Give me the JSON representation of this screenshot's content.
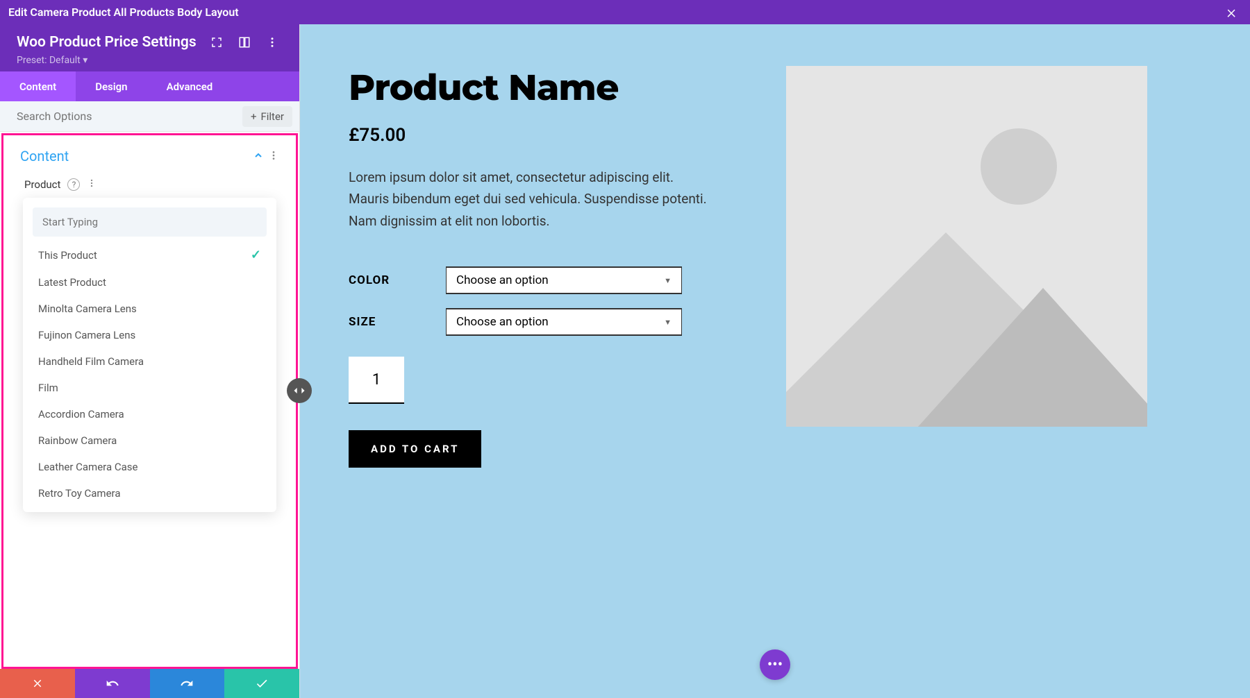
{
  "topBar": {
    "title": "Edit Camera Product All Products Body Layout"
  },
  "settingsHeader": {
    "title": "Woo Product Price Settings",
    "preset": "Preset: Default"
  },
  "tabs": {
    "content": "Content",
    "design": "Design",
    "advanced": "Advanced"
  },
  "search": {
    "placeholder": "Search Options",
    "filterLabel": "Filter"
  },
  "section": {
    "title": "Content",
    "fieldLabel": "Product"
  },
  "dropdown": {
    "searchPlaceholder": "Start Typing",
    "items": [
      "This Product",
      "Latest Product",
      "Minolta Camera Lens",
      "Fujinon Camera Lens",
      "Handheld Film Camera",
      "Film",
      "Accordion Camera",
      "Rainbow Camera",
      "Leather Camera Case",
      "Retro Toy Camera"
    ],
    "selectedIndex": 0
  },
  "product": {
    "title": "Product Name",
    "price": "£75.00",
    "description": "Lorem ipsum dolor sit amet, consectetur adipiscing elit. Mauris bibendum eget dui sed vehicula. Suspendisse potenti. Nam dignissim at elit non lobortis.",
    "colorLabel": "COLOR",
    "sizeLabel": "SIZE",
    "selectPlaceholder": "Choose an option",
    "quantity": "1",
    "addToCart": "ADD TO CART"
  }
}
